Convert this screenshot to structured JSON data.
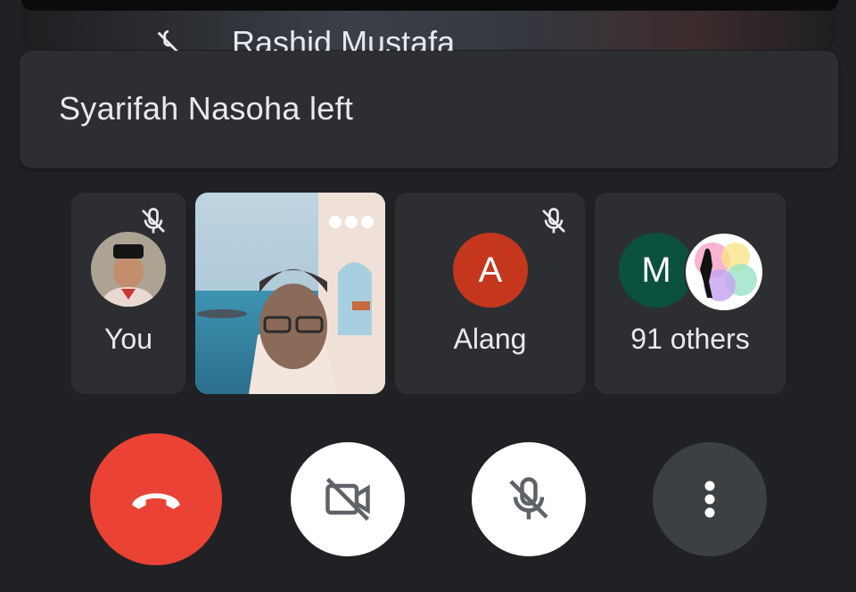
{
  "top_tile": {
    "name": "Rashid Mustafa",
    "mic_icon": "mic-off-icon"
  },
  "toast": {
    "text": "Syarifah Nasoha left"
  },
  "participants": [
    {
      "label": "You",
      "icon": "mic-off-icon"
    },
    {
      "label": "",
      "icon": "more-options-icon"
    },
    {
      "label": "Alang",
      "initial": "A",
      "icon": "mic-off-icon",
      "color": "#c5371d"
    },
    {
      "label": "91 others",
      "initial": "M",
      "color": "#0c5040"
    }
  ],
  "controls": {
    "end_call": {
      "icon": "hang-up-icon",
      "color": "#ea4335"
    },
    "camera": {
      "icon": "camera-off-icon"
    },
    "microphone": {
      "icon": "mic-off-icon"
    },
    "more": {
      "icon": "more-vert-icon"
    }
  },
  "colors": {
    "background": "#202124",
    "tile": "#2d2e31",
    "text": "#e8eaed"
  }
}
